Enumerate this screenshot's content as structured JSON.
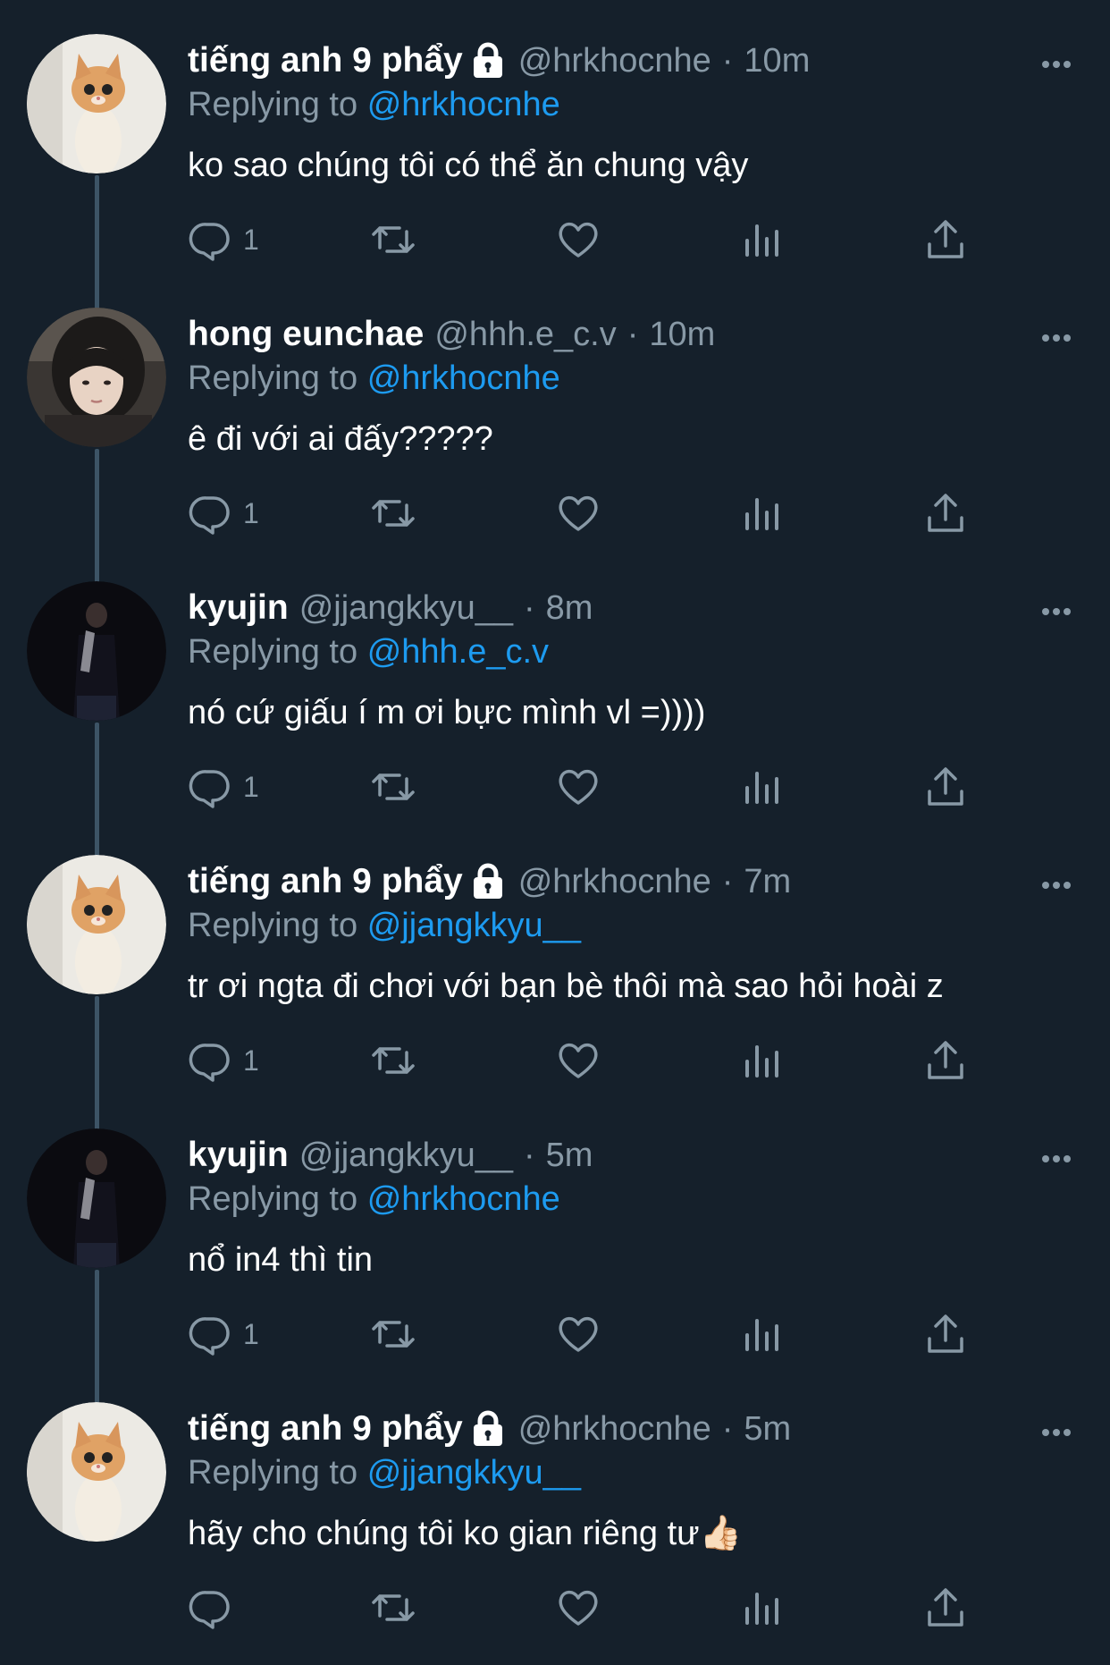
{
  "colors": {
    "background": "#15202b",
    "secondary_text": "#8899a6",
    "mention": "#1d9bf0",
    "thread_line": "#3d5466"
  },
  "tweets": [
    {
      "name": "tiếng anh 9 phẩy",
      "locked": true,
      "handle": "@hrkhocnhe",
      "dot": "·",
      "time": "10m",
      "replying_prefix": "Replying to",
      "replying_to": "@hrkhocnhe",
      "text": "ko sao chúng tôi có thể ăn chung vậy",
      "reply_count": "1",
      "avatar": "cat"
    },
    {
      "name": "hong eunchae",
      "locked": false,
      "handle": "@hhh.e_c.v",
      "dot": "·",
      "time": "10m",
      "replying_prefix": "Replying to",
      "replying_to": "@hrkhocnhe",
      "text": "ê đi với ai đấy?????",
      "reply_count": "1",
      "avatar": "girl"
    },
    {
      "name": "kyujin",
      "locked": false,
      "handle": "@jjangkkyu__",
      "dot": "·",
      "time": "8m",
      "replying_prefix": "Replying to",
      "replying_to": "@hhh.e_c.v",
      "text": "nó cứ giấu í m ơi bực mình vl =))))",
      "reply_count": "1",
      "avatar": "dark"
    },
    {
      "name": "tiếng anh 9 phẩy",
      "locked": true,
      "handle": "@hrkhocnhe",
      "dot": "·",
      "time": "7m",
      "replying_prefix": "Replying to",
      "replying_to": "@jjangkkyu__",
      "text": "tr ơi ngta đi chơi với bạn bè thôi mà sao hỏi hoài z",
      "reply_count": "1",
      "avatar": "cat"
    },
    {
      "name": "kyujin",
      "locked": false,
      "handle": "@jjangkkyu__",
      "dot": "·",
      "time": "5m",
      "replying_prefix": "Replying to",
      "replying_to": "@hrkhocnhe",
      "text": "nổ in4 thì tin",
      "reply_count": "1",
      "avatar": "dark"
    },
    {
      "name": "tiếng anh 9 phẩy",
      "locked": true,
      "handle": "@hrkhocnhe",
      "dot": "·",
      "time": "5m",
      "replying_prefix": "Replying to",
      "replying_to": "@jjangkkyu__",
      "text": "hãy cho chúng tôi ko gian riêng tư👍🏻",
      "reply_count": "",
      "avatar": "cat"
    }
  ]
}
